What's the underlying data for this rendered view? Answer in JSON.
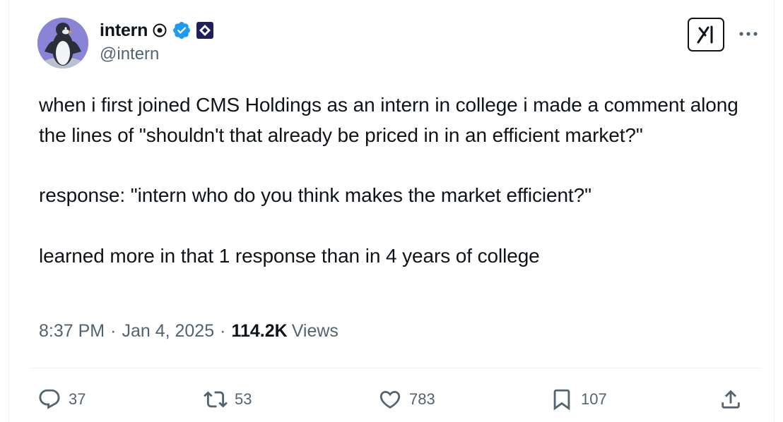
{
  "author": {
    "display_name": "intern",
    "handle": "@intern",
    "avatar_icon": "penguin-avatar-icon",
    "verified_color": "#1d9bf0"
  },
  "header": {
    "grok_icon": "grok-icon",
    "more_icon": "more-icon"
  },
  "tweet": {
    "paragraphs": [
      "when i first joined CMS Holdings as an intern in college i made a comment along the lines of \"shouldn't that already be priced in in an efficient market?\"",
      "response: \"intern who do you think makes the market efficient?\"",
      "learned more in that 1 response than in 4 years of college"
    ],
    "time": "8:37 PM",
    "separator": "·",
    "date": "Jan 4, 2025",
    "views_count": "114.2K",
    "views_label": "Views"
  },
  "actions": {
    "replies": "37",
    "reposts": "53",
    "likes": "783",
    "bookmarks": "107"
  },
  "colors": {
    "text_primary": "#0f1419",
    "text_secondary": "#536471",
    "divider": "#eff3f4"
  }
}
